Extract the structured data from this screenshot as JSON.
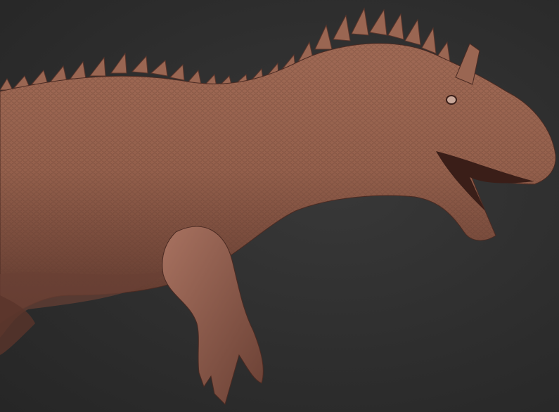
{
  "scene": {
    "subject_icon": "dinosaur-sculpt",
    "colors": {
      "background": "#2e2e2e",
      "skin_base": "#8c5a48",
      "skin_light": "#b07a64",
      "skin_shadow": "#4a2a22"
    }
  }
}
